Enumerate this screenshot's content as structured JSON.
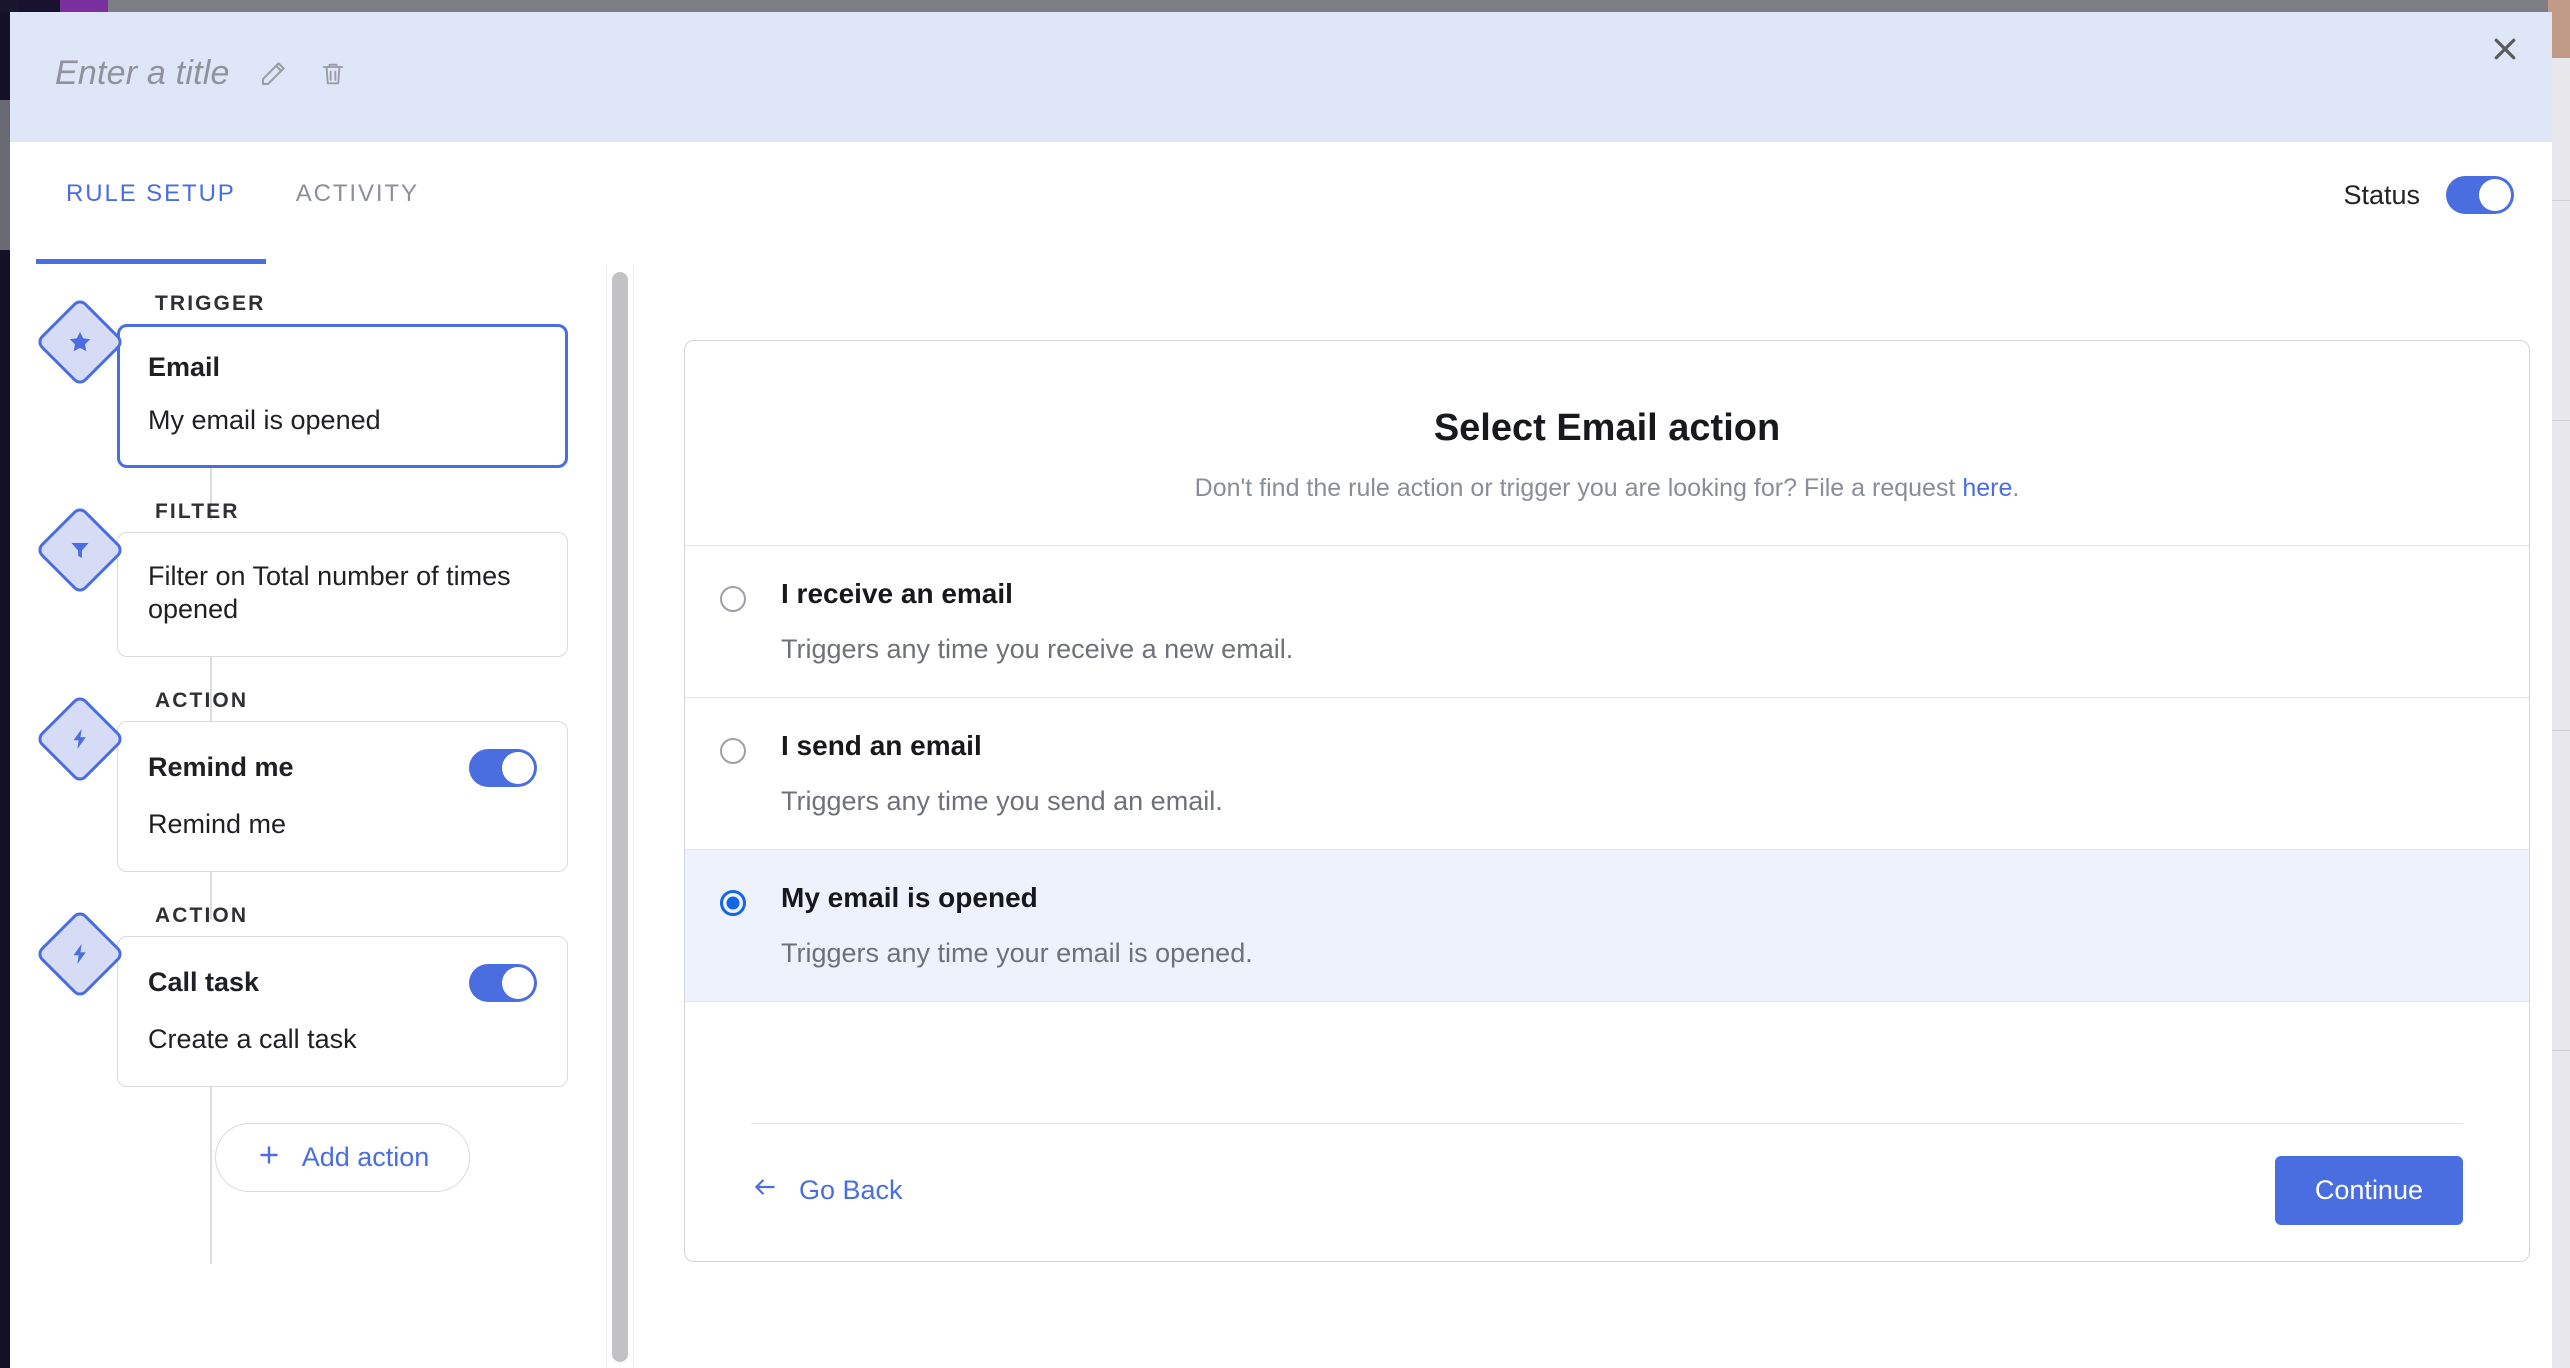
{
  "header": {
    "title_placeholder": "Enter a title",
    "edit_icon": "pencil-icon",
    "delete_icon": "trash-icon",
    "close_icon": "close-icon",
    "background_color": "#dfe6f7"
  },
  "tabs": [
    {
      "label": "RULE SETUP",
      "active": true
    },
    {
      "label": "ACTIVITY",
      "active": false
    }
  ],
  "status": {
    "label": "Status",
    "enabled": true,
    "accent_color": "#4a6ee0"
  },
  "flow": {
    "steps": [
      {
        "kind": "TRIGGER",
        "icon": "star-icon",
        "title": "Email",
        "subtitle": "My email is opened",
        "selected": true,
        "has_toggle": false
      },
      {
        "kind": "FILTER",
        "icon": "funnel-icon",
        "title": "",
        "subtitle": "Filter on Total number of times opened",
        "selected": false,
        "has_toggle": false
      },
      {
        "kind": "ACTION",
        "icon": "bolt-icon",
        "title": "Remind me",
        "subtitle": "Remind me",
        "selected": false,
        "has_toggle": true,
        "toggle_on": true
      },
      {
        "kind": "ACTION",
        "icon": "bolt-icon",
        "title": "Call task",
        "subtitle": "Create a call task",
        "selected": false,
        "has_toggle": true,
        "toggle_on": true
      }
    ],
    "add_action": {
      "label": "Add action",
      "icon": "plus-icon"
    }
  },
  "panel": {
    "title": "Select Email action",
    "subtitle_before": "Don't find the rule action or trigger you are looking for? File a request ",
    "subtitle_link": "here",
    "subtitle_after": ".",
    "options": [
      {
        "title": "I receive an email",
        "description": "Triggers any time you receive a new email.",
        "selected": false
      },
      {
        "title": "I send an email",
        "description": "Triggers any time you send an email.",
        "selected": false
      },
      {
        "title": "My email is opened",
        "description": "Triggers any time your email is opened.",
        "selected": true
      }
    ],
    "footer": {
      "back_label": "Go Back",
      "back_icon": "arrow-left-icon",
      "continue_label": "Continue"
    }
  },
  "scrollbar": {
    "orientation": "vertical"
  }
}
